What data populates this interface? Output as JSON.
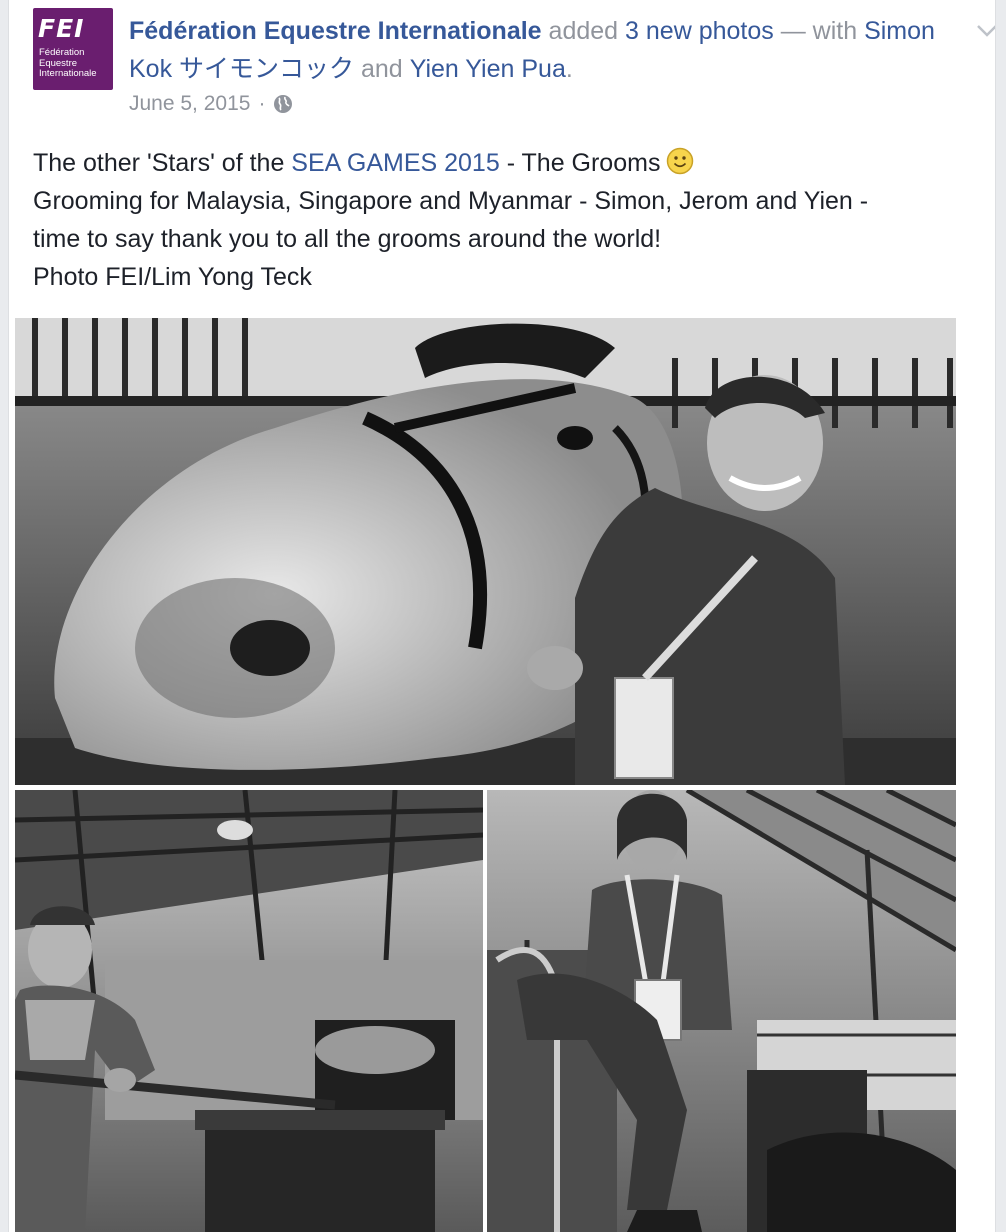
{
  "post": {
    "page_name": "Fédération Equestre Internationale",
    "action_text": "added",
    "photos_link": "3 new photos",
    "dash": "—",
    "with_text": "with",
    "tagged_1": "Simon Kok サイモンコック",
    "and_text": "and",
    "tagged_2": "Yien Yien Pua",
    "period": ".",
    "date": "June 5, 2015",
    "separator": "·",
    "privacy_icon": "globe-icon",
    "menu_icon": "chevron-down-icon"
  },
  "avatar": {
    "mark": "FEI",
    "subtitle": "Fédération\nEquestre\nInternationale",
    "bg_color": "#6a1e6f"
  },
  "message": {
    "line1_prefix": "The other 'Stars' of the ",
    "line1_link": "SEA GAMES 2015",
    "line1_suffix": " - The Grooms",
    "emoji": "smiley-icon",
    "line2": "Grooming for Malaysia, Singapore and Myanmar - Simon, Jerom and Yien -",
    "line3": "time to say thank you to all the grooms around the world!",
    "line4": "Photo FEI/Lim Yong Teck"
  },
  "photos": [
    {
      "subject": "groom-with-horse-photo"
    },
    {
      "subject": "groom-with-shovel-photo"
    },
    {
      "subject": "groom-in-stable-photo"
    }
  ],
  "colors": {
    "link": "#365899",
    "meta": "#90949c",
    "text": "#1d2129",
    "background": "#e9ebee"
  }
}
